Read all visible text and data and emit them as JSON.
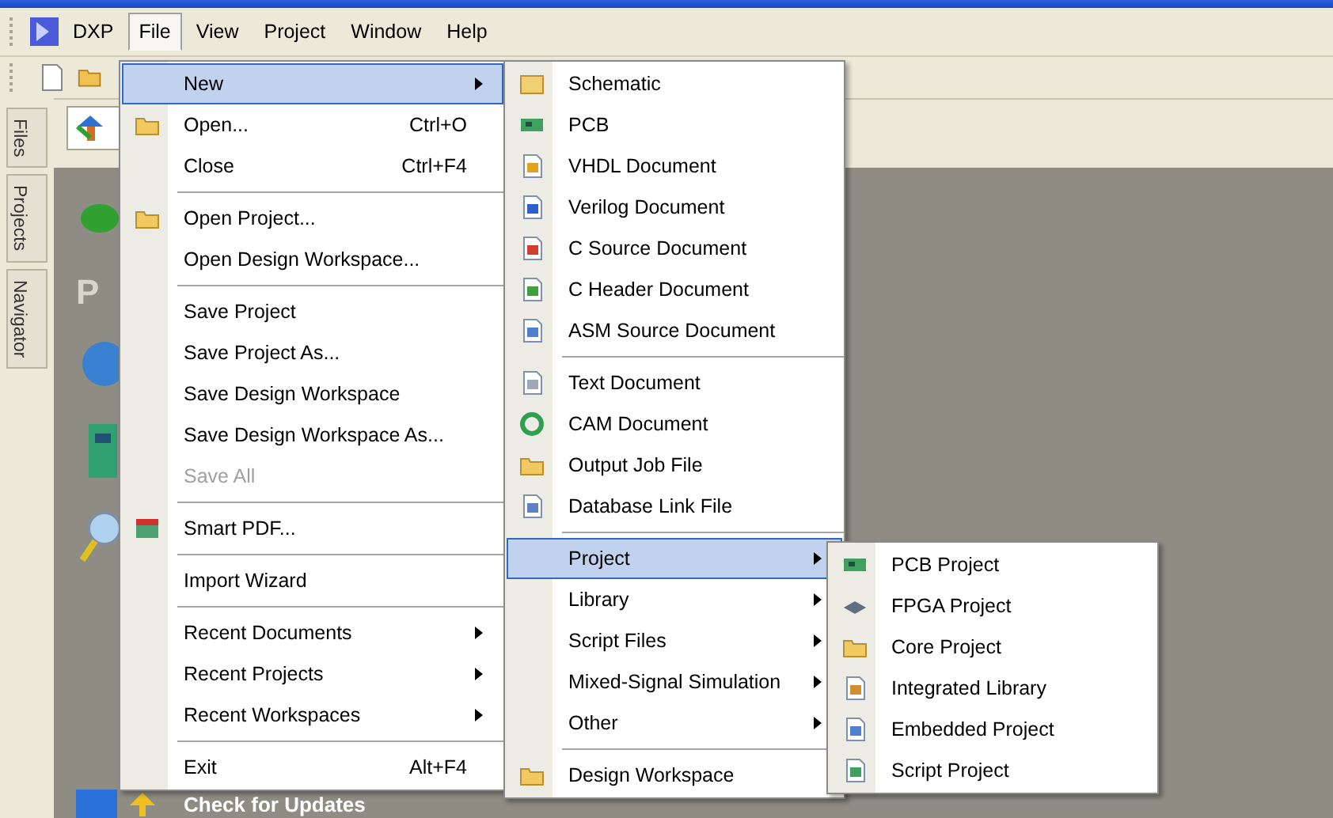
{
  "menubar": {
    "items": [
      {
        "label": "DXP",
        "selected": false,
        "logo": true
      },
      {
        "label": "File",
        "selected": true
      },
      {
        "label": "View",
        "selected": false
      },
      {
        "label": "Project",
        "selected": false
      },
      {
        "label": "Window",
        "selected": false
      },
      {
        "label": "Help",
        "selected": false
      }
    ]
  },
  "side_tabs": [
    "Files",
    "Projects",
    "Navigator"
  ],
  "panel": {
    "heading": "P",
    "footer": "Check for Updates"
  },
  "file_menu": [
    {
      "kind": "item",
      "label": "New",
      "submenu": true,
      "selected": true
    },
    {
      "kind": "item",
      "label": "Open...",
      "shortcut": "Ctrl+O",
      "selected": false
    },
    {
      "kind": "item",
      "label": "Close",
      "shortcut": "Ctrl+F4",
      "selected": false
    },
    {
      "kind": "separator"
    },
    {
      "kind": "item",
      "label": "Open Project...",
      "selected": false
    },
    {
      "kind": "item",
      "label": "Open Design Workspace...",
      "selected": false
    },
    {
      "kind": "separator"
    },
    {
      "kind": "item",
      "label": "Save Project",
      "selected": false
    },
    {
      "kind": "item",
      "label": "Save Project As...",
      "selected": false
    },
    {
      "kind": "item",
      "label": "Save Design Workspace",
      "selected": false
    },
    {
      "kind": "item",
      "label": "Save Design Workspace As...",
      "selected": false
    },
    {
      "kind": "item",
      "label": "Save All",
      "disabled": true,
      "selected": false
    },
    {
      "kind": "separator"
    },
    {
      "kind": "item",
      "label": "Smart PDF...",
      "selected": false
    },
    {
      "kind": "separator"
    },
    {
      "kind": "item",
      "label": "Import Wizard",
      "selected": false
    },
    {
      "kind": "separator"
    },
    {
      "kind": "item",
      "label": "Recent Documents",
      "submenu": true,
      "selected": false
    },
    {
      "kind": "item",
      "label": "Recent Projects",
      "submenu": true,
      "selected": false
    },
    {
      "kind": "item",
      "label": "Recent Workspaces",
      "submenu": true,
      "selected": false
    },
    {
      "kind": "separator"
    },
    {
      "kind": "item",
      "label": "Exit",
      "shortcut": "Alt+F4",
      "selected": false
    }
  ],
  "new_menu": [
    {
      "kind": "item",
      "label": "Schematic",
      "selected": false
    },
    {
      "kind": "item",
      "label": "PCB",
      "selected": false
    },
    {
      "kind": "item",
      "label": "VHDL Document",
      "selected": false
    },
    {
      "kind": "item",
      "label": "Verilog Document",
      "selected": false
    },
    {
      "kind": "item",
      "label": "C Source Document",
      "selected": false
    },
    {
      "kind": "item",
      "label": "C Header Document",
      "selected": false
    },
    {
      "kind": "item",
      "label": "ASM Source Document",
      "selected": false
    },
    {
      "kind": "separator"
    },
    {
      "kind": "item",
      "label": "Text Document",
      "selected": false
    },
    {
      "kind": "item",
      "label": "CAM Document",
      "selected": false
    },
    {
      "kind": "item",
      "label": "Output Job File",
      "selected": false
    },
    {
      "kind": "item",
      "label": "Database Link File",
      "selected": false
    },
    {
      "kind": "separator"
    },
    {
      "kind": "item",
      "label": "Project",
      "submenu": true,
      "selected": true
    },
    {
      "kind": "item",
      "label": "Library",
      "submenu": true,
      "selected": false
    },
    {
      "kind": "item",
      "label": "Script Files",
      "submenu": true,
      "selected": false
    },
    {
      "kind": "item",
      "label": "Mixed-Signal Simulation",
      "submenu": true,
      "selected": false
    },
    {
      "kind": "item",
      "label": "Other",
      "submenu": true,
      "selected": false
    },
    {
      "kind": "separator"
    },
    {
      "kind": "item",
      "label": "Design Workspace",
      "selected": false
    }
  ],
  "project_menu": [
    {
      "kind": "item",
      "label": "PCB Project",
      "selected": false
    },
    {
      "kind": "item",
      "label": "FPGA Project",
      "selected": false
    },
    {
      "kind": "item",
      "label": "Core Project",
      "selected": false
    },
    {
      "kind": "item",
      "label": "Integrated Library",
      "selected": false
    },
    {
      "kind": "item",
      "label": "Embedded Project",
      "selected": false
    },
    {
      "kind": "item",
      "label": "Script Project",
      "selected": false
    }
  ]
}
